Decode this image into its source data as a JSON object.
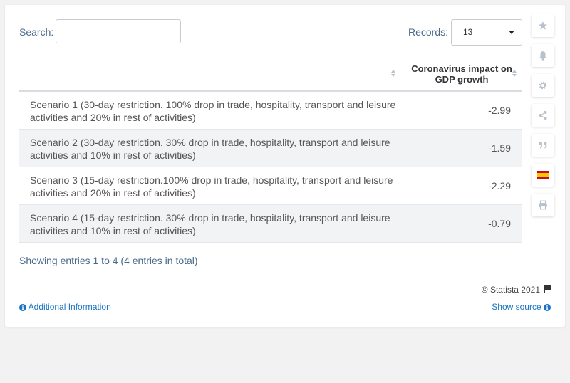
{
  "search": {
    "label": "Search:",
    "value": "",
    "placeholder": ""
  },
  "records": {
    "label": "Records:",
    "selected": "13"
  },
  "table": {
    "columns": [
      "",
      "Coronavirus impact on GDP growth"
    ],
    "rows": [
      {
        "scenario": "Scenario 1 (30-day restriction. 100% drop in trade, hospitality, transport and leisure activities and 20% in rest of activities)",
        "value": "-2.99"
      },
      {
        "scenario": "Scenario 2 (30-day restriction. 30% drop in trade, hospitality, transport and leisure activities and 10% in rest of activities)",
        "value": "-1.59"
      },
      {
        "scenario": "Scenario 3 (15-day restriction.100% drop in trade, hospitality, transport and leisure activities and 20% in rest of activities)",
        "value": "-2.29"
      },
      {
        "scenario": "Scenario 4 (15-day restriction. 30% drop in trade, hospitality, transport and leisure activities and 10% in rest of activities)",
        "value": "-0.79"
      }
    ]
  },
  "footer": {
    "showing": "Showing entries 1 to 4 (4 entries in total)",
    "copyright": "© Statista 2021",
    "additional_info": "Additional Information",
    "show_source": "Show source"
  },
  "sidebar": {
    "icons": [
      "star-icon",
      "bell-icon",
      "gear-icon",
      "share-icon",
      "quote-icon",
      "spain-flag-icon",
      "print-icon"
    ]
  },
  "colors": {
    "accent": "#1a73c2",
    "text_muted": "#4a6a8a",
    "row_alt": "#f1f3f5",
    "flag_red": "#c60b1e",
    "flag_yellow": "#ffc400"
  }
}
